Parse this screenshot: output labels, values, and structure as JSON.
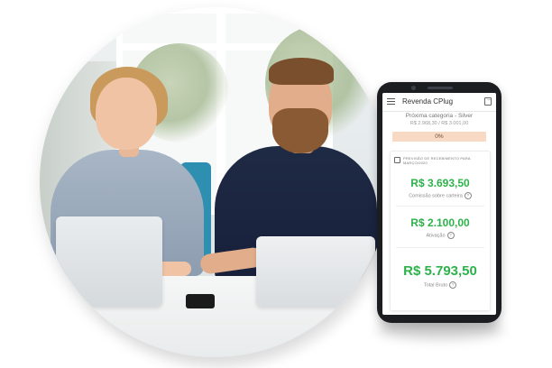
{
  "app": {
    "title": "Revenda CPlug"
  },
  "category": {
    "next_label": "Próxima categoria - Silver",
    "range": "R$ 2.968,30 / R$ 3.001,00",
    "progress_percent": 0,
    "progress_label": "0%"
  },
  "earnings": {
    "heading": "PREVISÃO DE RECEBIMENTO PARA MARÇO/2020",
    "items": [
      {
        "value": "R$ 3.693,50",
        "caption": "Comissão sobre carteira"
      },
      {
        "value": "R$ 2.100,00",
        "caption": "Ativação"
      },
      {
        "value": "R$ 5.793,50",
        "caption": "Total Bruto"
      }
    ]
  },
  "icons": {
    "menu": "hamburger-menu-icon",
    "logout": "logout-icon",
    "help": "help-circle-icon",
    "calendar": "calendar-icon"
  },
  "colors": {
    "value_green": "#2db24a",
    "progress_bg": "#f7d9c4",
    "phone_body": "#1c1d20"
  }
}
